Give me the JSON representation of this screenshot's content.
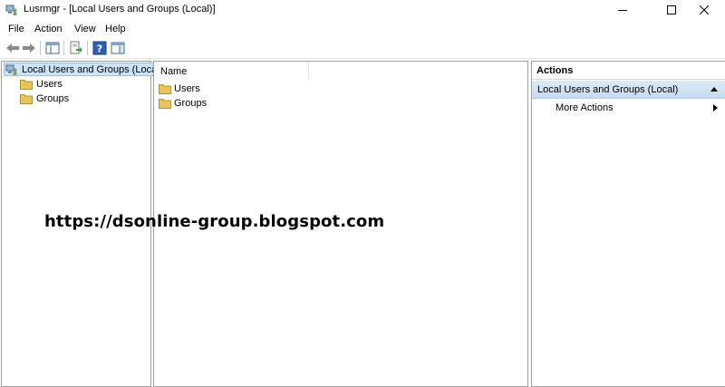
{
  "window": {
    "title": "Lusrmgr - [Local Users and Groups (Local)]",
    "icon": "computer-users-icon",
    "controls": [
      "minimize-icon",
      "maximize-icon",
      "close-icon"
    ]
  },
  "menu": {
    "file": "File",
    "action": "Action",
    "view": "View",
    "help": "Help"
  },
  "toolbar": {
    "icons": [
      "back-arrow-icon",
      "forward-arrow-icon",
      "show-console-tree-icon",
      "export-list-icon",
      "help-icon",
      "show-action-pane-icon"
    ]
  },
  "tree": {
    "root": "Local Users and Groups (Local)",
    "children": [
      {
        "label": "Users",
        "icon": "folder-icon"
      },
      {
        "label": "Groups",
        "icon": "folder-icon"
      }
    ]
  },
  "list": {
    "column_name": "Name",
    "rows": [
      {
        "label": "Users",
        "icon": "folder-icon"
      },
      {
        "label": "Groups",
        "icon": "folder-icon"
      }
    ]
  },
  "actions": {
    "header": "Actions",
    "section_title": "Local Users and Groups (Local)",
    "items": [
      {
        "label": "More Actions"
      }
    ]
  },
  "watermark": "https://dsonline-group.blogspot.com",
  "colors": {
    "selection": "#cce4f7",
    "section_bg": "#c7dcf1",
    "folder": "#e8c45c"
  }
}
